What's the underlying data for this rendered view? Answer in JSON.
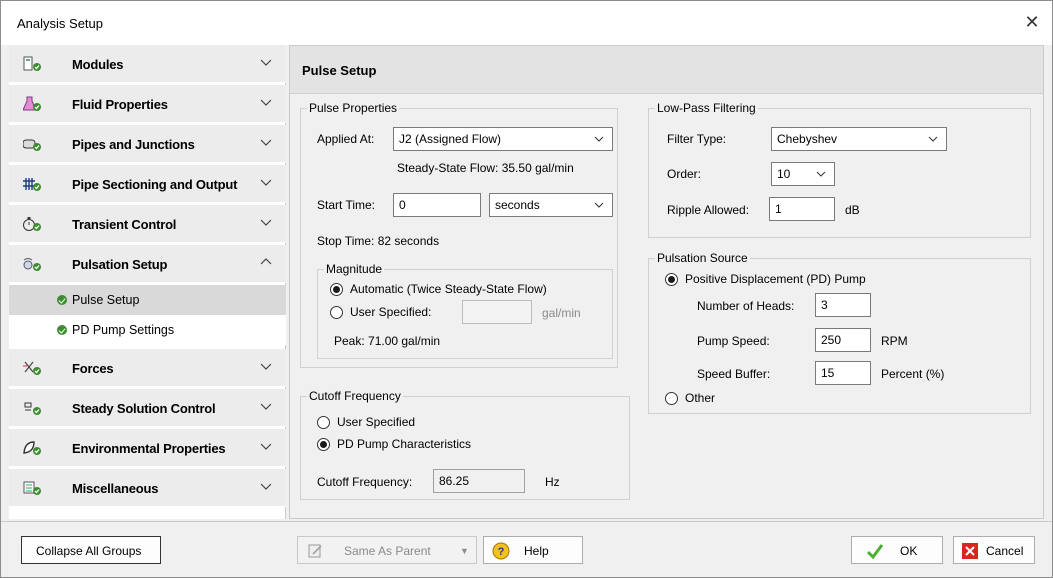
{
  "window": {
    "title": "Analysis Setup"
  },
  "sidebar": {
    "groups": [
      {
        "label": "Modules",
        "icon": "modules-icon",
        "expanded": false
      },
      {
        "label": "Fluid Properties",
        "icon": "flask-icon",
        "expanded": false
      },
      {
        "label": "Pipes and Junctions",
        "icon": "pipe-icon",
        "expanded": false
      },
      {
        "label": "Pipe Sectioning and Output",
        "icon": "grid-icon",
        "expanded": false
      },
      {
        "label": "Transient Control",
        "icon": "stopwatch-icon",
        "expanded": false
      },
      {
        "label": "Pulsation Setup",
        "icon": "pulsation-icon",
        "expanded": true,
        "items": [
          {
            "label": "Pulse Setup",
            "selected": true
          },
          {
            "label": "PD Pump Settings",
            "selected": false
          }
        ]
      },
      {
        "label": "Forces",
        "icon": "forces-icon",
        "expanded": false
      },
      {
        "label": "Steady Solution Control",
        "icon": "solution-icon",
        "expanded": false
      },
      {
        "label": "Environmental Properties",
        "icon": "leaf-icon",
        "expanded": false
      },
      {
        "label": "Miscellaneous",
        "icon": "misc-icon",
        "expanded": false
      }
    ]
  },
  "panel": {
    "title": "Pulse Setup",
    "pulse_properties": {
      "legend": "Pulse Properties",
      "applied_at_label": "Applied At:",
      "applied_at_value": "J2 (Assigned Flow)",
      "steady_flow": "Steady-State Flow: 35.50 gal/min",
      "start_time_label": "Start Time:",
      "start_time_value": "0",
      "start_time_unit": "seconds",
      "stop_time": "Stop Time:  82 seconds",
      "magnitude": {
        "legend": "Magnitude",
        "automatic": "Automatic (Twice Steady-State Flow)",
        "user_specified": "User Specified:",
        "unit": "gal/min",
        "peak": "Peak: 71.00 gal/min"
      }
    },
    "cutoff": {
      "legend": "Cutoff Frequency",
      "user_specified": "User Specified",
      "pd_pump": "PD Pump Characteristics",
      "freq_label": "Cutoff Frequency:",
      "freq_value": "86.25",
      "freq_unit": "Hz"
    },
    "lowpass": {
      "legend": "Low-Pass Filtering",
      "filter_type_label": "Filter Type:",
      "filter_type_value": "Chebyshev",
      "order_label": "Order:",
      "order_value": "10",
      "ripple_label": "Ripple Allowed:",
      "ripple_value": "1",
      "ripple_unit": "dB"
    },
    "source": {
      "legend": "Pulsation Source",
      "pd_pump": "Positive Displacement (PD) Pump",
      "heads_label": "Number of Heads:",
      "heads_value": "3",
      "speed_label": "Pump Speed:",
      "speed_value": "250",
      "speed_unit": "RPM",
      "buffer_label": "Speed Buffer:",
      "buffer_value": "15",
      "buffer_unit": "Percent (%)",
      "other": "Other"
    }
  },
  "footer": {
    "collapse": "Collapse All Groups",
    "same_as_parent": "Same As Parent",
    "help": "Help",
    "ok": "OK",
    "cancel": "Cancel"
  },
  "colors": {
    "check_green": "#3c8d2f",
    "cancel_red": "#d9261c"
  }
}
